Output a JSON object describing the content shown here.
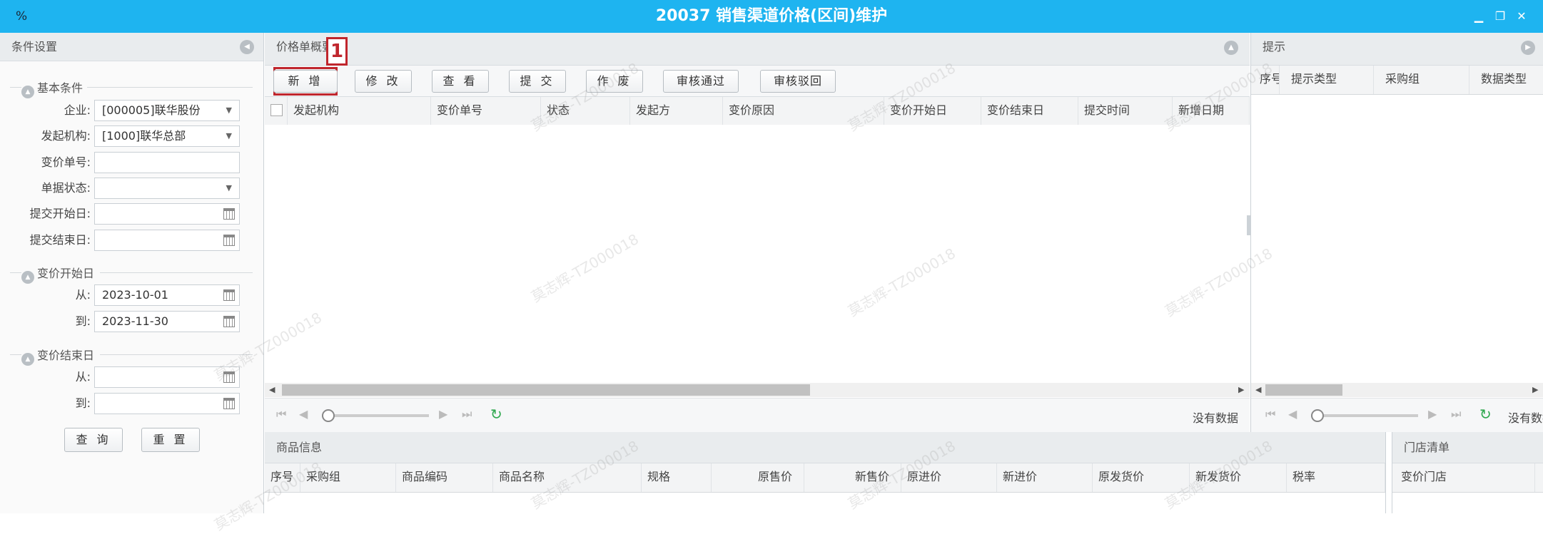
{
  "window": {
    "icon_glyph": "%",
    "title": "20037 销售渠道价格(区间)维护",
    "minimize_glyph": "▁",
    "restore_glyph": "❐",
    "close_glyph": "✕"
  },
  "left_panel": {
    "header": "条件设置",
    "section_basic": "基本条件",
    "fields": {
      "enterprise_label": "企业:",
      "enterprise_value": "[000005]联华股份",
      "org_label": "发起机构:",
      "org_value": "[1000]联华总部",
      "doc_no_label": "变价单号:",
      "status_label": "单据状态:",
      "submit_start_label": "提交开始日:",
      "submit_end_label": "提交结束日:"
    },
    "section_start": "变价开始日",
    "start_from_label": "从:",
    "start_from_value": "2023-10-01",
    "start_to_label": "到:",
    "start_to_value": "2023-11-30",
    "section_end": "变价结束日",
    "end_from_label": "从:",
    "end_to_label": "到:",
    "query_button": "查 询",
    "reset_button": "重 置"
  },
  "center_panel": {
    "header": "价格单概要",
    "annotation_number": "1",
    "toolbar": [
      "新 增",
      "修 改",
      "查 看",
      "提 交",
      "作 废",
      "审核通过",
      "审核驳回"
    ],
    "columns": [
      "发起机构",
      "变价单号",
      "状态",
      "发起方",
      "变价原因",
      "变价开始日",
      "变价结束日",
      "提交时间",
      "新增日期"
    ],
    "no_data": "没有数据"
  },
  "right_panel": {
    "header": "提示",
    "columns": [
      "序号",
      "提示类型",
      "采购组",
      "数据类型"
    ],
    "no_data": "没有数据"
  },
  "bottom_panel": {
    "goods_header": "商品信息",
    "goods_columns": [
      "序号",
      "采购组",
      "商品编码",
      "商品名称",
      "规格",
      "原售价",
      "新售价",
      "原进价",
      "新进价",
      "原发货价",
      "新发货价",
      "税率"
    ],
    "store_header": "门店清单",
    "store_columns": [
      "变价门店"
    ]
  },
  "watermark_text": "莫志辉-TZ000018",
  "colors": {
    "titlebar": "#1eb4f0",
    "annotation_red": "#c0262d",
    "refresh_green": "#2fa84f"
  }
}
